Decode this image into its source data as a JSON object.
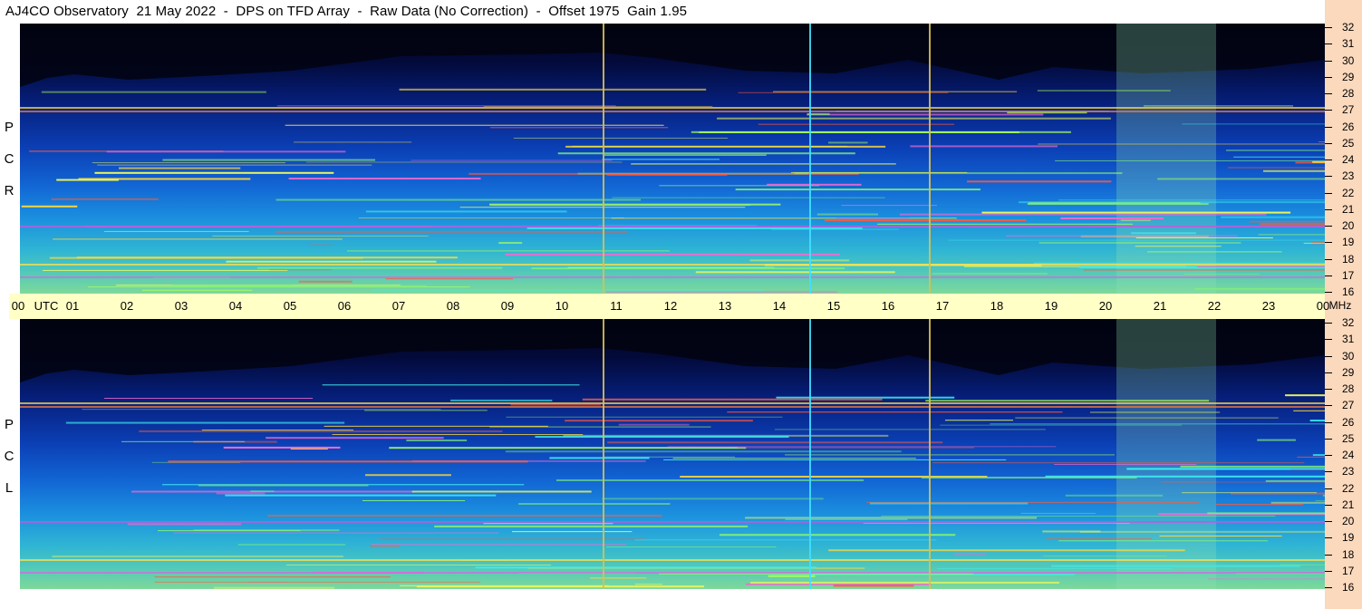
{
  "title": "AJ4CO Observatory  21 May 2022  -  DPS on TFD Array  -  Raw Data (No Correction)  -  Offset 1975  Gain 1.95",
  "colors": {
    "background_strip": "#fbd9bd",
    "time_axis": "#ffffc6"
  },
  "chart_data": [
    {
      "type": "heatmap",
      "panel": "RCP",
      "side_label_letters": [
        "P",
        "C",
        "R"
      ],
      "x": {
        "unit": "UTC",
        "range": [
          0,
          24
        ]
      },
      "y": {
        "unit": "MHz",
        "range": [
          16,
          32
        ]
      },
      "grid": false
    },
    {
      "type": "heatmap",
      "panel": "LCP",
      "side_label_letters": [
        "P",
        "C",
        "L"
      ],
      "x": {
        "unit": "UTC",
        "range": [
          0,
          24
        ]
      },
      "y": {
        "unit": "MHz",
        "range": [
          16,
          32
        ]
      },
      "grid": false
    }
  ],
  "time_axis": {
    "labels": [
      "00",
      "01",
      "02",
      "03",
      "04",
      "05",
      "06",
      "07",
      "08",
      "09",
      "10",
      "11",
      "12",
      "13",
      "14",
      "15",
      "16",
      "17",
      "18",
      "19",
      "20",
      "21",
      "22",
      "23",
      "00"
    ],
    "utc_label": "UTC",
    "mhz_label": "MHz"
  },
  "freq_axis_labels": [
    "32",
    "31",
    "30",
    "29",
    "28",
    "27",
    "26",
    "25",
    "24",
    "23",
    "22",
    "21",
    "20",
    "19",
    "18",
    "17",
    "16"
  ]
}
